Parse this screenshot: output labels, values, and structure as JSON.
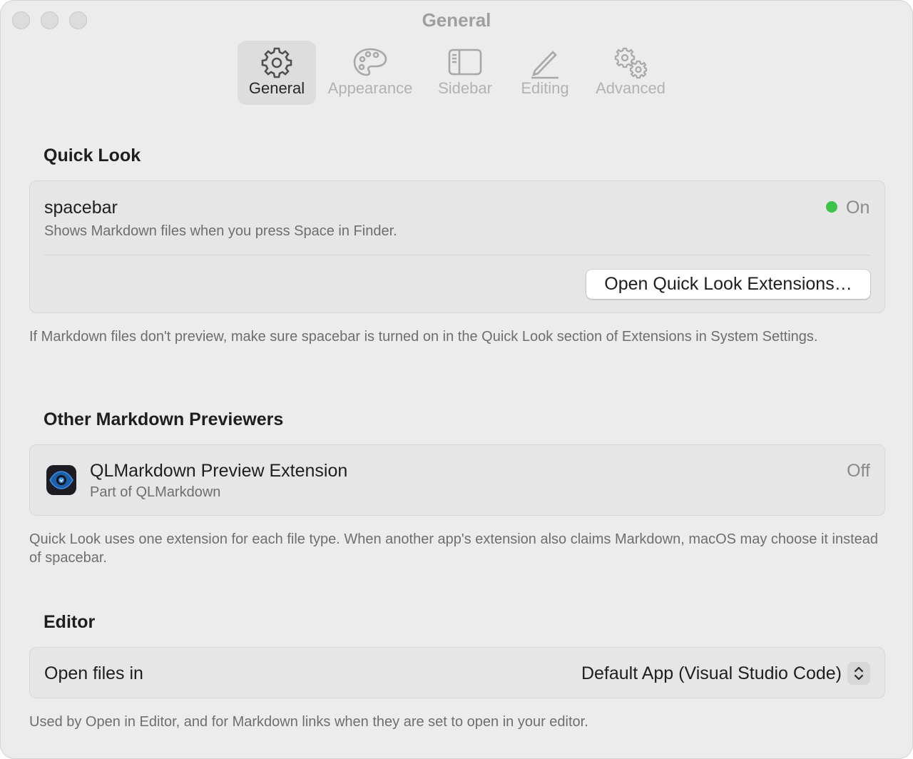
{
  "window": {
    "title": "General"
  },
  "toolbar": {
    "tabs": [
      {
        "label": "General",
        "icon": "gear-icon",
        "selected": true
      },
      {
        "label": "Appearance",
        "icon": "palette-icon",
        "selected": false
      },
      {
        "label": "Sidebar",
        "icon": "sidebar-icon",
        "selected": false
      },
      {
        "label": "Editing",
        "icon": "pencil-icon",
        "selected": false
      },
      {
        "label": "Advanced",
        "icon": "gears-icon",
        "selected": false
      }
    ]
  },
  "quick_look": {
    "heading": "Quick Look",
    "extension_name": "spacebar",
    "description": "Shows Markdown files when you press Space in Finder.",
    "status": "On",
    "status_color": "#3ec24b",
    "button_label": "Open Quick Look Extensions…",
    "footnote": "If Markdown files don't preview, make sure spacebar is turned on in the Quick Look section of Extensions in System Settings."
  },
  "other_previewers": {
    "heading": "Other Markdown Previewers",
    "items": [
      {
        "name": "QLMarkdown Preview Extension",
        "subtitle": "Part of QLMarkdown",
        "status": "Off",
        "icon": "eye-icon"
      }
    ],
    "footnote": "Quick Look uses one extension for each file type. When another app's extension also claims Markdown, macOS may choose it instead of spacebar."
  },
  "editor": {
    "heading": "Editor",
    "label": "Open files in",
    "selected_value": "Default App (Visual Studio Code)",
    "footnote": "Used by Open in Editor, and for Markdown links when they are set to open in your editor."
  }
}
